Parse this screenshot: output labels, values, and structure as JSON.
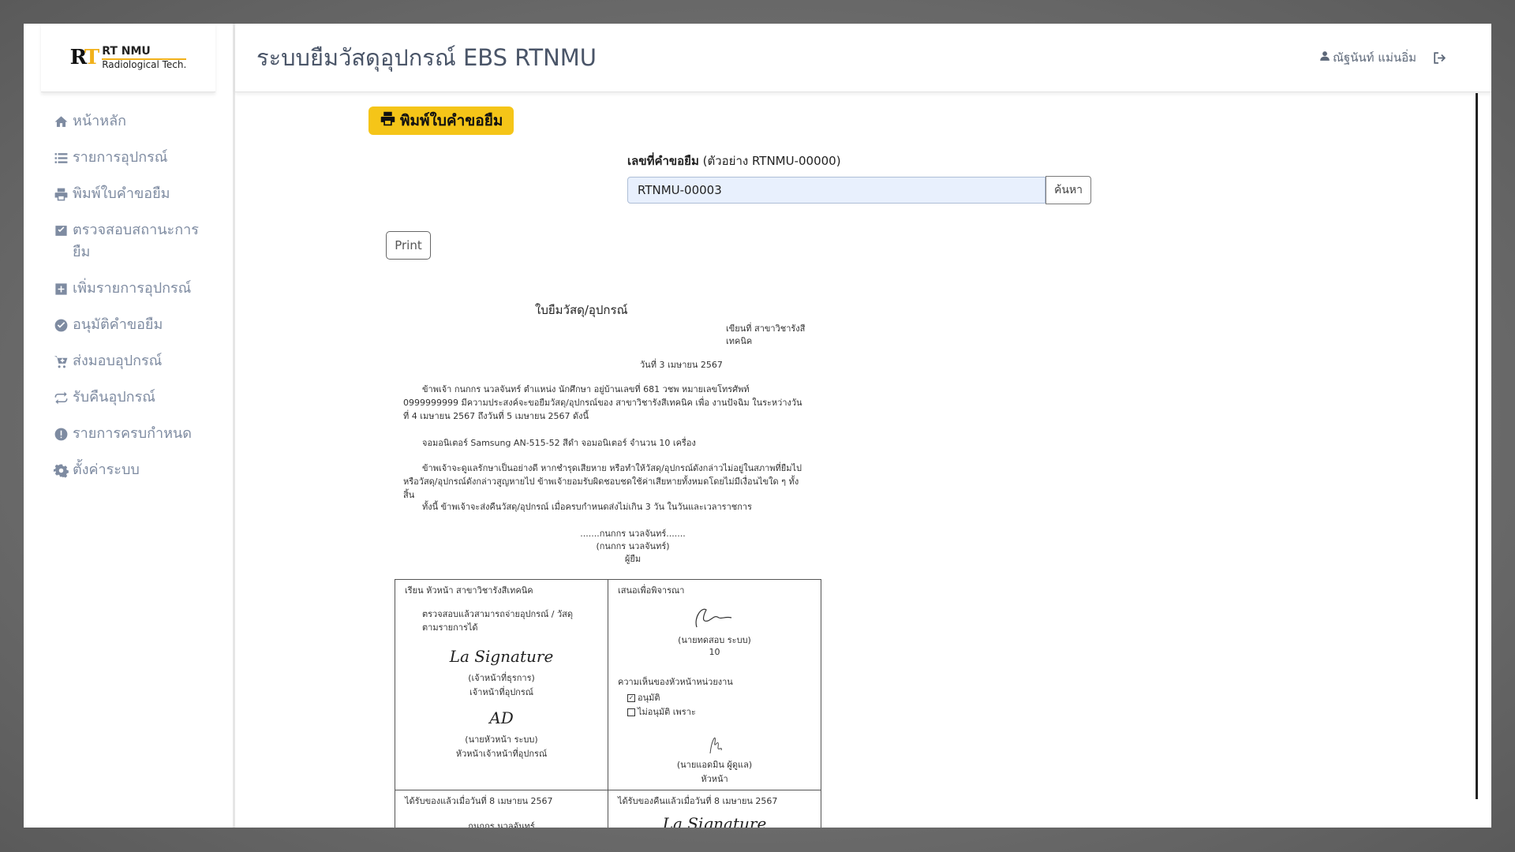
{
  "brand": {
    "mark": "RT",
    "name": "RT NMU",
    "sub": "Radiological Tech."
  },
  "sidebar": {
    "items": [
      {
        "label": "หน้าหลัก",
        "icon": "home-icon"
      },
      {
        "label": "รายการอุปกรณ์",
        "icon": "list-icon"
      },
      {
        "label": "พิมพ์ใบคำขอยืม",
        "icon": "printer-icon"
      },
      {
        "label": "ตรวจสอบสถานะการยืม",
        "icon": "inbox-check-icon"
      },
      {
        "label": "เพิ่มรายการอุปกรณ์",
        "icon": "plus-square-icon"
      },
      {
        "label": "อนุมัติคำขอยืม",
        "icon": "check-circle-icon"
      },
      {
        "label": "ส่งมอบอุปกรณ์",
        "icon": "cart-icon"
      },
      {
        "label": "รับคืนอุปกรณ์",
        "icon": "return-icon"
      },
      {
        "label": "รายการครบกำหนด",
        "icon": "alert-circle-icon"
      },
      {
        "label": "ตั้งค่าระบบ",
        "icon": "gear-icon"
      }
    ]
  },
  "header": {
    "title": "ระบบยืมวัสดุอุปกรณ์ EBS RTNMU",
    "user": "ณัฐนันท์ แม่นอิ่ม"
  },
  "main": {
    "print_request_button": "พิมพ์ใบคำขอยืม",
    "request_label_bold": "เลขที่คำขอยืม",
    "request_label_hint": " (ตัวอย่าง RTNMU-00000)",
    "request_value": "RTNMU-00003",
    "search_button": "ค้นหา",
    "print_button": "Print"
  },
  "document": {
    "title": "ใบยืมวัสดุ/อุปกรณ์",
    "place_line1": "เขียนที่ สาขาวิชารังสี",
    "place_line2": "เทคนิค",
    "date": "วันที่ 3 เมษายน 2567",
    "para1": "ข้าพเจ้า กนกกร นวลจันทร์ ตำแหน่ง นักศึกษา อยู่บ้านเลขที่ 681 วชพ หมายเลขโทรศัพท์ 0999999999 มีความประสงค์จะขอยืมวัสดุ/อุปกรณ์ของ สาขาวิชารังสีเทคนิค เพื่อ งานปัจฉิม ในระหว่างวันที่ 4 เมษายน 2567 ถึงวันที่ 5 เมษายน 2567 ดังนี้",
    "item_line": "จอมอนิเตอร์ Samsung AN-515-52 สีดำ จอมอนิเตอร์      จำนวน 10 เครื่อง",
    "para2": "ข้าพเจ้าจะดูแลรักษาเป็นอย่างดี หากชำรุดเสียหาย หรือทำให้วัสดุ/อุปกรณ์ดังกล่าวไม่อยู่ในสภาพที่ยืมไป หรือวัสดุ/อุปกรณ์ดังกล่าวสูญหายไป ข้าพเจ้ายอมรับผิดชอบชดใช้ค่าเสียหายทั้งหมดโดยไม่มีเงื่อนไขใด ๆ ทั้งสิ้น",
    "para3": "ทั้งนี้ ข้าพเจ้าจะส่งคืนวัสดุ/อุปกรณ์ เมื่อครบกำหนดส่งไม่เกิน 3 วัน ในวันและเวลาราชการ",
    "borrower_sign": ".......กนกกร นวลจันทร์.......",
    "borrower_name": "(กนกกร นวลจันทร์)",
    "borrower_role": "ผู้ยืม",
    "cell1_head": "เรียน หัวหน้า สาขาวิชารังสีเทคนิค",
    "cell1_text": "ตรวจสอบแล้วสามารถจ่ายอุปกรณ์ / วัสดุตามรายการได้",
    "cell1_sig1": "La Signature",
    "cell1_name1": "(เจ้าหน้าที่ธุรการ)",
    "cell1_role1": "เจ้าหน้าที่อุปกรณ์",
    "cell1_sig2": "AD",
    "cell1_name2": "(นายหัวหน้า ระบบ)",
    "cell1_role2": "หัวหน้าเจ้าหน้าที่อุปกรณ์",
    "cell2_head": "เสนอเพื่อพิจารณา",
    "cell2_name1": "(นายทดสอบ ระบบ)",
    "cell2_num": "10",
    "cell2_opinion": "ความเห็นของหัวหน้าหน่วยงาน",
    "cell2_approve": "อนุมัติ",
    "cell2_reject": "ไม่อนุมัติ เพราะ",
    "cell2_name2": "(นายแอดมิน ผู้ดูแล)",
    "cell2_role2": "หัวหน้า",
    "cell3_head": "ได้รับของแล้วเมื่อวันที่ 8 เมษายน 2567",
    "cell3_sign": ".......กนกกร นวลจันทร์.......",
    "cell4_head": "ได้รับของคืนแล้วเมื่อวันที่ 8 เมษายน 2567",
    "cell4_sig": "La Signature"
  },
  "colors": {
    "accent": "#f5c518",
    "sidebar_text": "#7e8ba1",
    "input_bg": "#e8f0fd"
  }
}
